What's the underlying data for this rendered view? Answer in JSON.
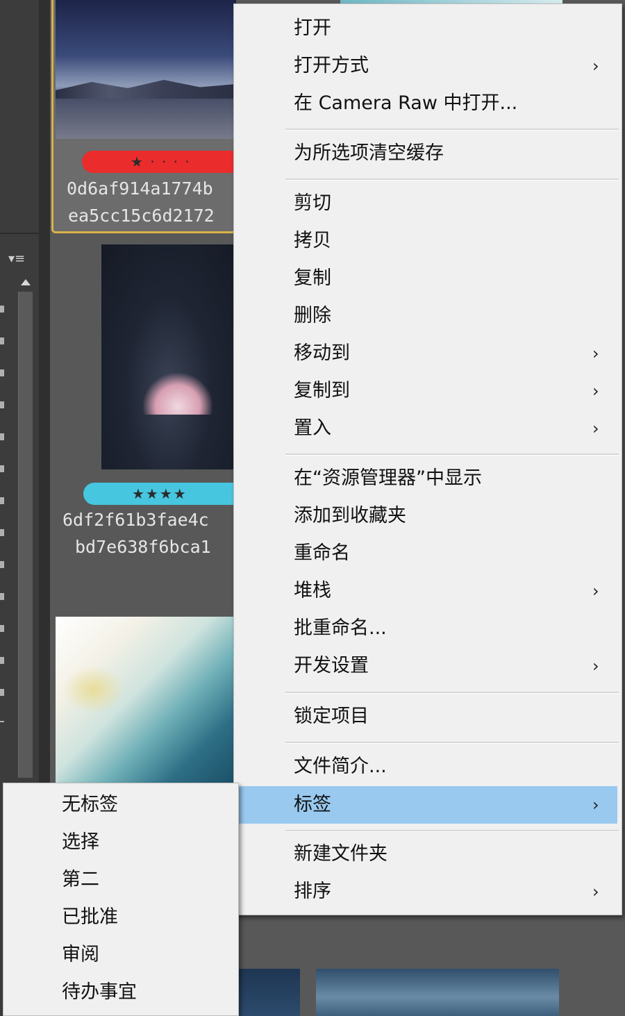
{
  "thumbnails": [
    {
      "filename_line1": "0d6af914a1774b",
      "filename_line2": "ea5cc15c6d2172",
      "rating_stars": "★ · · · ·",
      "label_color": "#ea2c2c"
    },
    {
      "filename_line1": "6df2f61b3fae4c",
      "filename_line2": "bd7e638f6bca1",
      "rating_stars": "★★★★",
      "label_color": "#46c6df"
    }
  ],
  "panel": {
    "menu_icon": "▾≡"
  },
  "context_menu": {
    "items": [
      {
        "label": "打开",
        "has_submenu": false
      },
      {
        "label": "打开方式",
        "has_submenu": true
      },
      {
        "label": "在 Camera Raw 中打开...",
        "has_submenu": false
      },
      {
        "label": "为所选项清空缓存",
        "has_submenu": false
      },
      {
        "label": "剪切",
        "has_submenu": false
      },
      {
        "label": "拷贝",
        "has_submenu": false
      },
      {
        "label": "复制",
        "has_submenu": false
      },
      {
        "label": "删除",
        "has_submenu": false
      },
      {
        "label": "移动到",
        "has_submenu": true
      },
      {
        "label": "复制到",
        "has_submenu": true
      },
      {
        "label": "置入",
        "has_submenu": true
      },
      {
        "label": "在“资源管理器”中显示",
        "has_submenu": false
      },
      {
        "label": "添加到收藏夹",
        "has_submenu": false
      },
      {
        "label": "重命名",
        "has_submenu": false
      },
      {
        "label": "堆栈",
        "has_submenu": true
      },
      {
        "label": "批重命名...",
        "has_submenu": false
      },
      {
        "label": "开发设置",
        "has_submenu": true
      },
      {
        "label": "锁定项目",
        "has_submenu": false
      },
      {
        "label": "文件简介...",
        "has_submenu": false
      },
      {
        "label": "标签",
        "has_submenu": true,
        "highlighted": true
      },
      {
        "label": "新建文件夹",
        "has_submenu": false
      },
      {
        "label": "排序",
        "has_submenu": true
      }
    ],
    "submenu_arrow": "›",
    "highlight_color": "#99c9ef"
  },
  "label_submenu": {
    "items": [
      "无标签",
      "选择",
      "第二",
      "已批准",
      "审阅",
      "待办事宜"
    ]
  }
}
